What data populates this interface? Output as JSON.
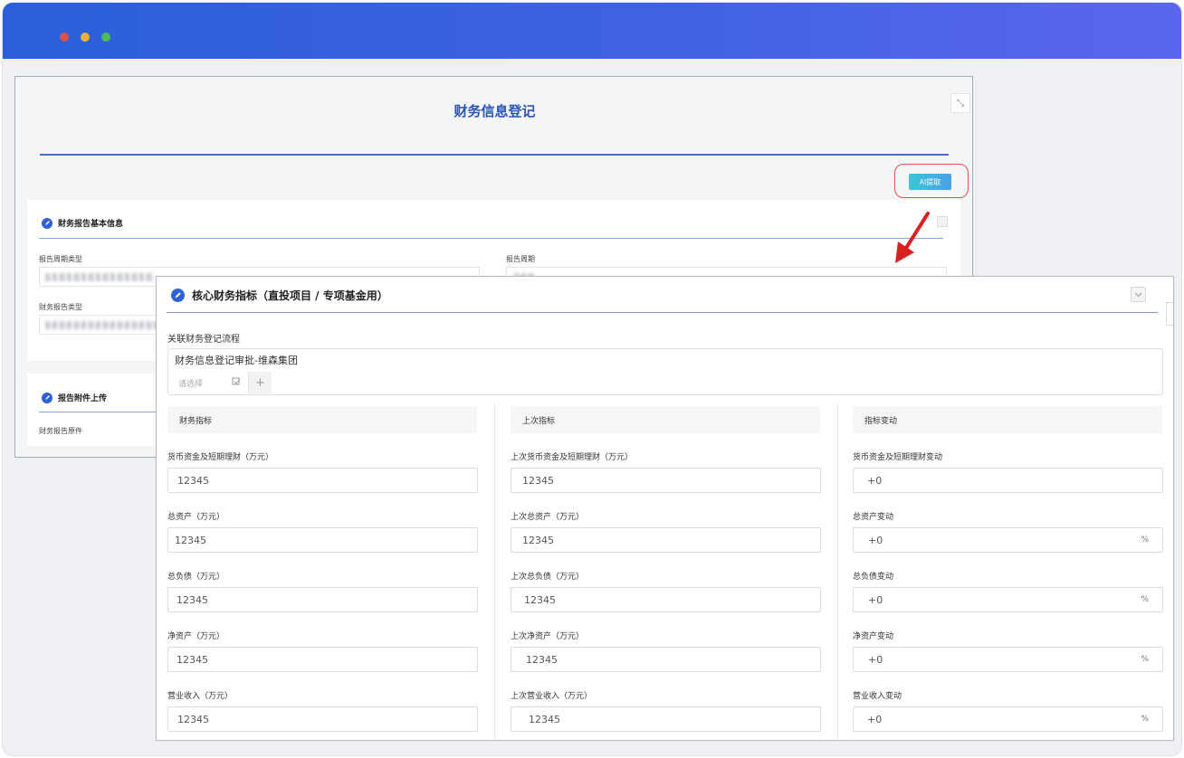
{
  "window": {
    "title": "财务信息登记",
    "ai_button": "AI提取",
    "expand_icon": "⤡"
  },
  "bg_sections": {
    "basic": {
      "title": "财务报告基本信息",
      "label_period_type": "报告周期类型",
      "label_period": "报告周期",
      "label_report_type": "财务报告类型"
    },
    "attachments": {
      "title": "报告附件上传",
      "label_original": "财务报告原件"
    }
  },
  "panel": {
    "title": "核心财务指标（直投项目 / 专项基金用）",
    "flow_label": "关联财务登记流程",
    "flow_value": "财务信息登记审批-维森集团",
    "flow_placeholder": "请选择",
    "flow_add": "+",
    "columns": [
      {
        "header": "财务指标"
      },
      {
        "header": "上次指标"
      },
      {
        "header": "指标变动"
      }
    ],
    "rows": [
      {
        "current": {
          "label": "货币资金及短期理财（万元）",
          "value": "12345"
        },
        "previous": {
          "label": "上次货币资金及短期理财（万元）",
          "value": "12345"
        },
        "change": {
          "label": "货币资金及短期理财变动",
          "value": "+0",
          "unit": ""
        }
      },
      {
        "current": {
          "label": "总资产（万元）",
          "value": "12345"
        },
        "previous": {
          "label": "上次总资产（万元）",
          "value": "12345"
        },
        "change": {
          "label": "总资产变动",
          "value": "+0",
          "unit": "%"
        }
      },
      {
        "current": {
          "label": "总负债（万元）",
          "value": "12345"
        },
        "previous": {
          "label": "上次总负债（万元）",
          "value": "12345"
        },
        "change": {
          "label": "总负债变动",
          "value": "+0",
          "unit": "%"
        }
      },
      {
        "current": {
          "label": "净资产（万元）",
          "value": "12345"
        },
        "previous": {
          "label": "上次净资产（万元）",
          "value": "12345"
        },
        "change": {
          "label": "净资产变动",
          "value": "+0",
          "unit": "%"
        }
      },
      {
        "current": {
          "label": "营业收入（万元）",
          "value": "12345"
        },
        "previous": {
          "label": "上次营业收入（万元）",
          "value": "12345"
        },
        "change": {
          "label": "营业收入变动",
          "value": "+0",
          "unit": "%"
        }
      }
    ]
  },
  "colors": {
    "titlebar_start": "#2b5fd9",
    "titlebar_end": "#5b66ec",
    "accent": "#2f62d6",
    "highlight_ring": "#e3504a",
    "arrow": "#d92020"
  },
  "icons": {
    "section_icon": "pen-circle-icon",
    "collapse_icon": "chevron-down-icon",
    "picker_icon": "select-icon",
    "add_icon": "plus-icon"
  }
}
